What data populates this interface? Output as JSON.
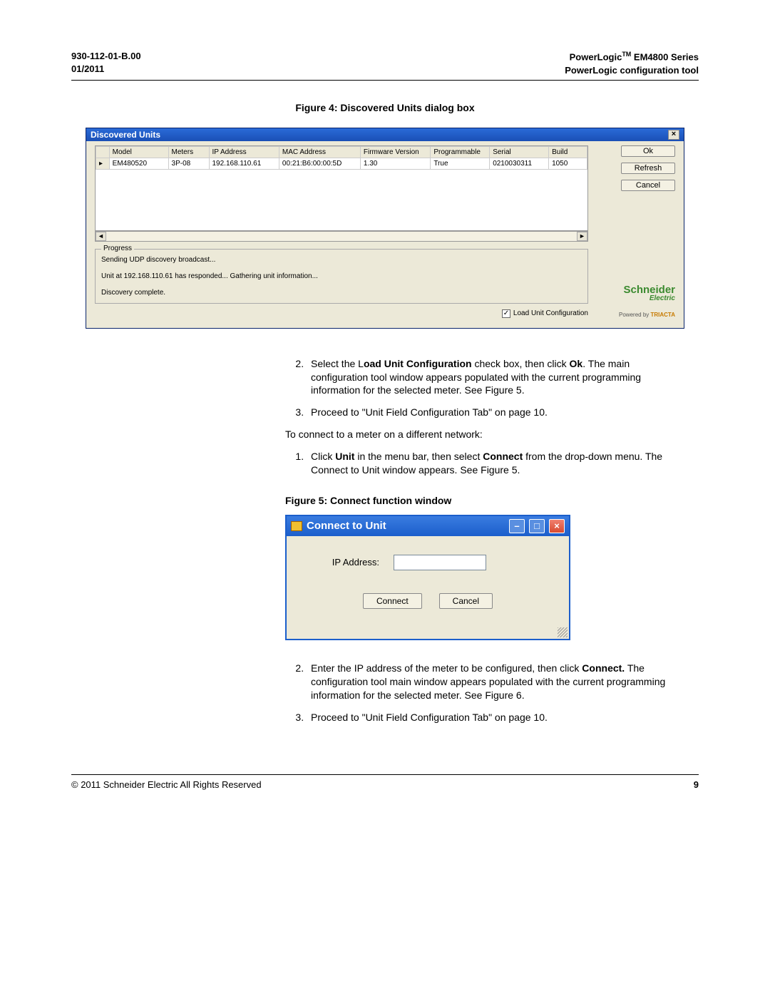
{
  "header": {
    "left_line1": "930-112-01-B.00",
    "left_line2": "01/2011",
    "right_line1_a": "PowerLogic",
    "right_line1_tm": "TM",
    "right_line1_b": " EM4800 Series",
    "right_line2": "PowerLogic configuration tool"
  },
  "fig4_caption": "Figure 4:  Discovered Units dialog box",
  "dlg1": {
    "title": "Discovered Units",
    "close_glyph": "×",
    "buttons": {
      "ok": "Ok",
      "refresh": "Refresh",
      "cancel": "Cancel"
    },
    "columns": [
      "",
      "Model",
      "Meters",
      "IP Address",
      "MAC Address",
      "Firmware Version",
      "Programmable",
      "Serial",
      "Build"
    ],
    "row": {
      "sel": "▸",
      "model": "EM480520",
      "meters": "3P-08",
      "ip": "192.168.110.61",
      "mac": "00:21:B6:00:00:5D",
      "fw": "1.30",
      "prog": "True",
      "serial": "0210030311",
      "build": "1050"
    },
    "scroll_left": "◄",
    "scroll_right": "►",
    "progress_legend": "Progress",
    "progress_lines": [
      "Sending UDP discovery broadcast...",
      "Unit at 192.168.110.61 has responded... Gathering unit information...",
      "Discovery complete."
    ],
    "chk_glyph": "✓",
    "chk_label": "Load Unit Configuration",
    "schneider": "Schneider",
    "schneider_sub": "Electric",
    "triacta_a": "Powered by ",
    "triacta_b": "TRIACTA"
  },
  "body1": {
    "item2_a": "Select the L",
    "item2_b": "oad Unit Configuration",
    "item2_c": " check box, then click ",
    "item2_d": "Ok",
    "item2_e": ". The main configuration tool window appears populated with the current programming information for the selected meter. See Figure 5.",
    "item3": "Proceed to \"Unit Field Configuration Tab\" on page 10.",
    "p1": "To connect to a meter on a different network:",
    "s2_item1_a": "Click ",
    "s2_item1_b": "Unit",
    "s2_item1_c": " in the menu bar, then select ",
    "s2_item1_d": "Connect",
    "s2_item1_e": " from the drop-down menu. The Connect to Unit window appears. See Figure 5."
  },
  "fig5_caption": "Figure 5:  Connect function window",
  "dlg2": {
    "title": "Connect to Unit",
    "min": "–",
    "max": "□",
    "close": "×",
    "ip_label": "IP Address:",
    "connect": "Connect",
    "cancel": "Cancel"
  },
  "body2": {
    "item2_a": "Enter the IP address of the meter to be configured, then click ",
    "item2_b": "Connect.",
    "item2_c": " The configuration tool main window appears populated with the current programming information for the selected meter. See Figure 6.",
    "item3": "Proceed to \"Unit Field Configuration Tab\" on page 10."
  },
  "footer": {
    "left": "© 2011 Schneider Electric All Rights Reserved",
    "right": "9"
  }
}
